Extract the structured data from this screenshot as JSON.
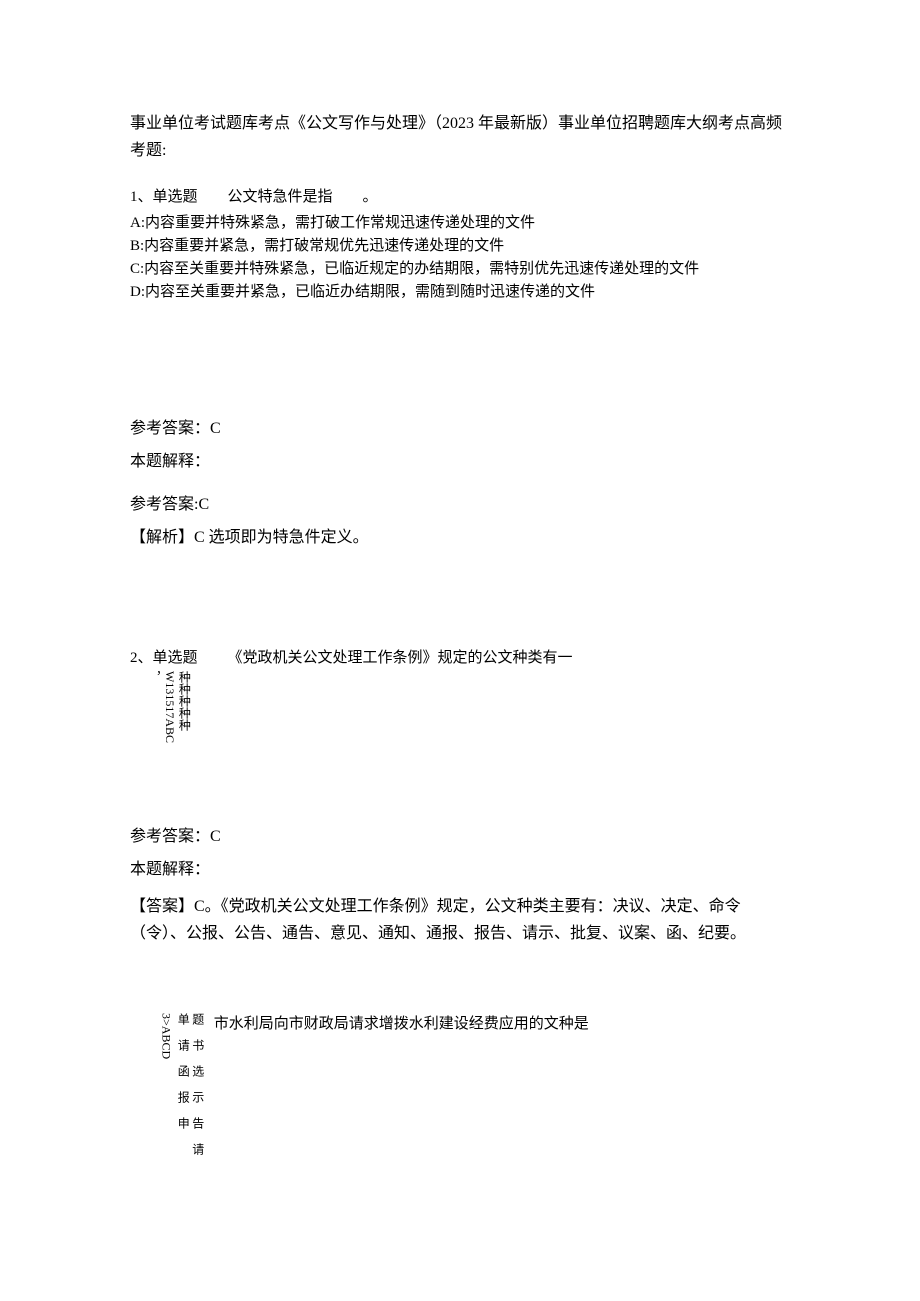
{
  "title": "事业单位考试题库考点《公文写作与处理》（2023 年最新版）事业单位招聘题库大纲考点高频考题:",
  "q1": {
    "head": "1、单选题  公文特急件是指  。",
    "optA": "A:内容重要并特殊紧急，需打破工作常规迅速传递处理的文件",
    "optB": "B:内容重要并紧急，需打破常规优先迅速传递处理的文件",
    "optC": "C:内容至关重要并特殊紧急，已临近规定的办结期限，需特别优先迅速传递处理的文件",
    "optD": "D:内容至关重要并紧急，已临近办结期限，需随到随时迅速传递的文件",
    "ansKey": "参考答案：C",
    "expLabel": "本题解释：",
    "ans2": "参考答案:C",
    "expl": "【解析】C 选项即为特急件定义。"
  },
  "q2": {
    "lead": "2、单选题",
    "comma": "，",
    "enCol": "W131517ABC",
    "zhCol": "种种种种种",
    "stem": "《党政机关公文处理工作条例》规定的公文种类有一",
    "ansKey": "参考答案：C",
    "expLabel": "本题解释：",
    "expl": "【答案】C。《党政机关公文处理工作条例》规定，公文种类主要有：决议、决定、命令（令）、公报、公告、通告、意见、通知、通报、报告、请示、批复、议案、函、纪要。"
  },
  "q3": {
    "enCol": "3>ABCD",
    "zhCol1": "单 请 函 报 申",
    "zhCol2": "题 书 选 示 告 请",
    "stem": "市水利局向市财政局请求增拨水利建设经费应用的文种是"
  }
}
